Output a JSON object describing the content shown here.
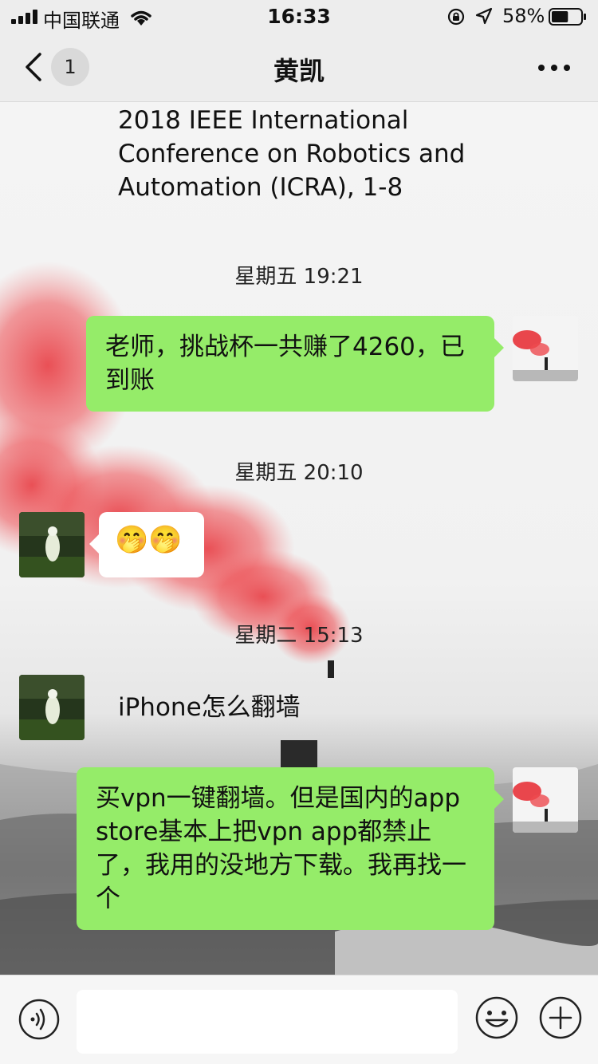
{
  "status_bar": {
    "carrier": "中国联通",
    "time": "16:33",
    "battery_percent": "58%",
    "battery_level": 0.58,
    "icons": [
      "signal-icon",
      "wifi-icon",
      "orientation-lock-icon",
      "location-icon",
      "battery-icon"
    ]
  },
  "nav": {
    "back_icon": "chevron-left-icon",
    "unread_count": "1",
    "title": "黄凯",
    "more_icon": "more-dots-icon"
  },
  "messages": {
    "m0": {
      "text": "2018 IEEE International Conference on Robotics and Automation (ICRA), 1-8"
    },
    "t1": "星期五 19:21",
    "m1": {
      "text": "老师，挑战杯一共赚了4260，已到账"
    },
    "t2": "星期五 20:10",
    "m2": {
      "text": "🤭🤭"
    },
    "t3": "星期二 15:13",
    "m3": {
      "text": "iPhone怎么翻墙"
    },
    "m4": {
      "text": "买vpn一键翻墙。但是国内的app store基本上把vpn app都禁止了，我用的没地方下载。我再找一个"
    }
  },
  "input_bar": {
    "placeholder": "",
    "icons": [
      "voice-icon",
      "emoji-icon",
      "plus-icon"
    ]
  },
  "colors": {
    "outgoing_bubble": "#95ec69",
    "incoming_bubble": "#ffffff",
    "bar_background": "#ededed"
  }
}
